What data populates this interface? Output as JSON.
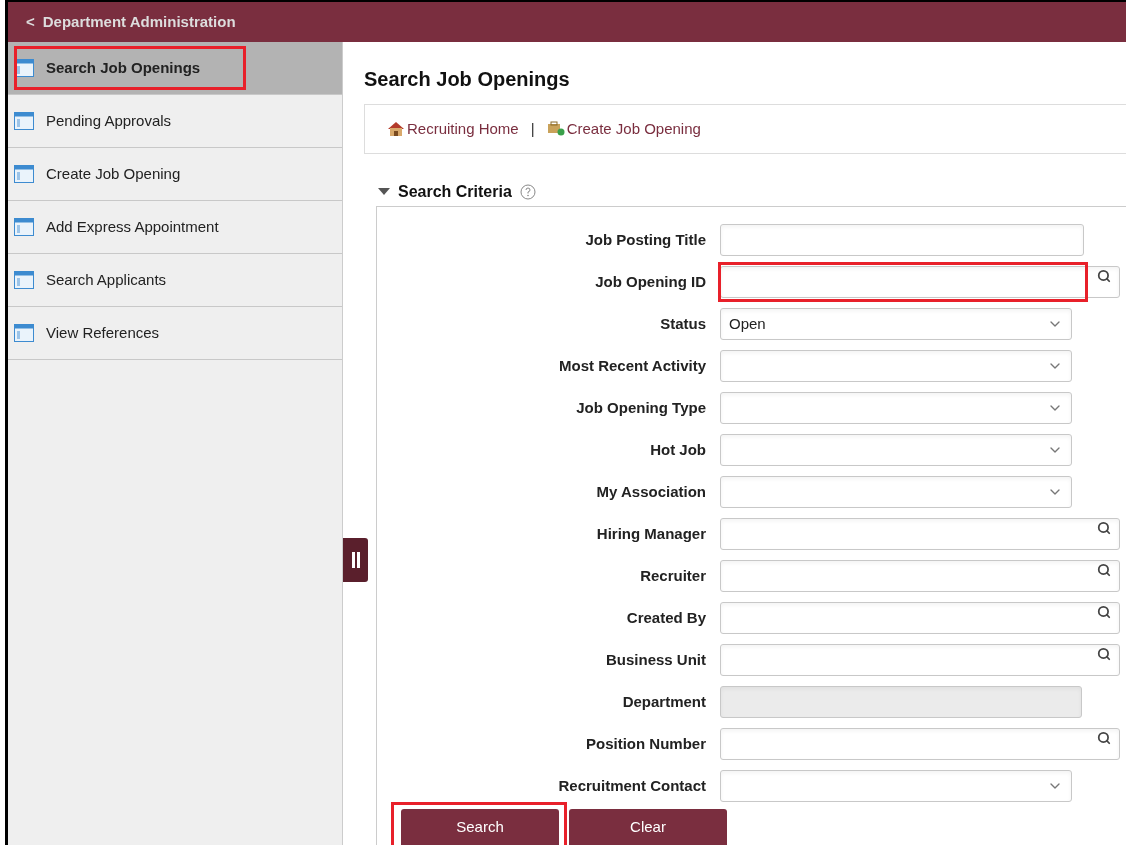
{
  "header": {
    "back_icon": "<",
    "title": "Department Administration"
  },
  "sidebar": {
    "items": [
      {
        "label": "Search Job Openings",
        "selected": true,
        "highlighted": true
      },
      {
        "label": "Pending Approvals",
        "selected": false,
        "highlighted": false
      },
      {
        "label": "Create Job Opening",
        "selected": false,
        "highlighted": false
      },
      {
        "label": "Add Express Appointment",
        "selected": false,
        "highlighted": false
      },
      {
        "label": "Search Applicants",
        "selected": false,
        "highlighted": false
      },
      {
        "label": "View References",
        "selected": false,
        "highlighted": false
      }
    ]
  },
  "page_title": "Search Job Openings",
  "links": [
    {
      "kind": "home",
      "label": "Recruiting Home"
    },
    {
      "kind": "create",
      "label": "Create Job Opening"
    }
  ],
  "link_separator": "|",
  "section": {
    "title": "Search Criteria",
    "expanded": true,
    "fields": [
      {
        "label": "Job Posting Title",
        "kind": "text",
        "highlighted": false
      },
      {
        "label": "Job Opening ID",
        "kind": "lookup",
        "highlighted": true
      },
      {
        "label": "Status",
        "kind": "select",
        "value": "Open",
        "highlighted": false
      },
      {
        "label": "Most Recent Activity",
        "kind": "select",
        "highlighted": false
      },
      {
        "label": "Job Opening Type",
        "kind": "select",
        "highlighted": false
      },
      {
        "label": "Hot Job",
        "kind": "select",
        "highlighted": false
      },
      {
        "label": "My Association",
        "kind": "select",
        "highlighted": false
      },
      {
        "label": "Hiring Manager",
        "kind": "lookup",
        "highlighted": false
      },
      {
        "label": "Recruiter",
        "kind": "lookup",
        "highlighted": false
      },
      {
        "label": "Created By",
        "kind": "lookup",
        "highlighted": false
      },
      {
        "label": "Business Unit",
        "kind": "lookup",
        "highlighted": false
      },
      {
        "label": "Department",
        "kind": "disabled",
        "highlighted": false
      },
      {
        "label": "Position Number",
        "kind": "lookup",
        "highlighted": false
      },
      {
        "label": "Recruitment Contact",
        "kind": "select",
        "highlighted": false
      }
    ]
  },
  "buttons": [
    {
      "label": "Search",
      "highlighted": true
    },
    {
      "label": "Clear",
      "highlighted": false
    }
  ]
}
